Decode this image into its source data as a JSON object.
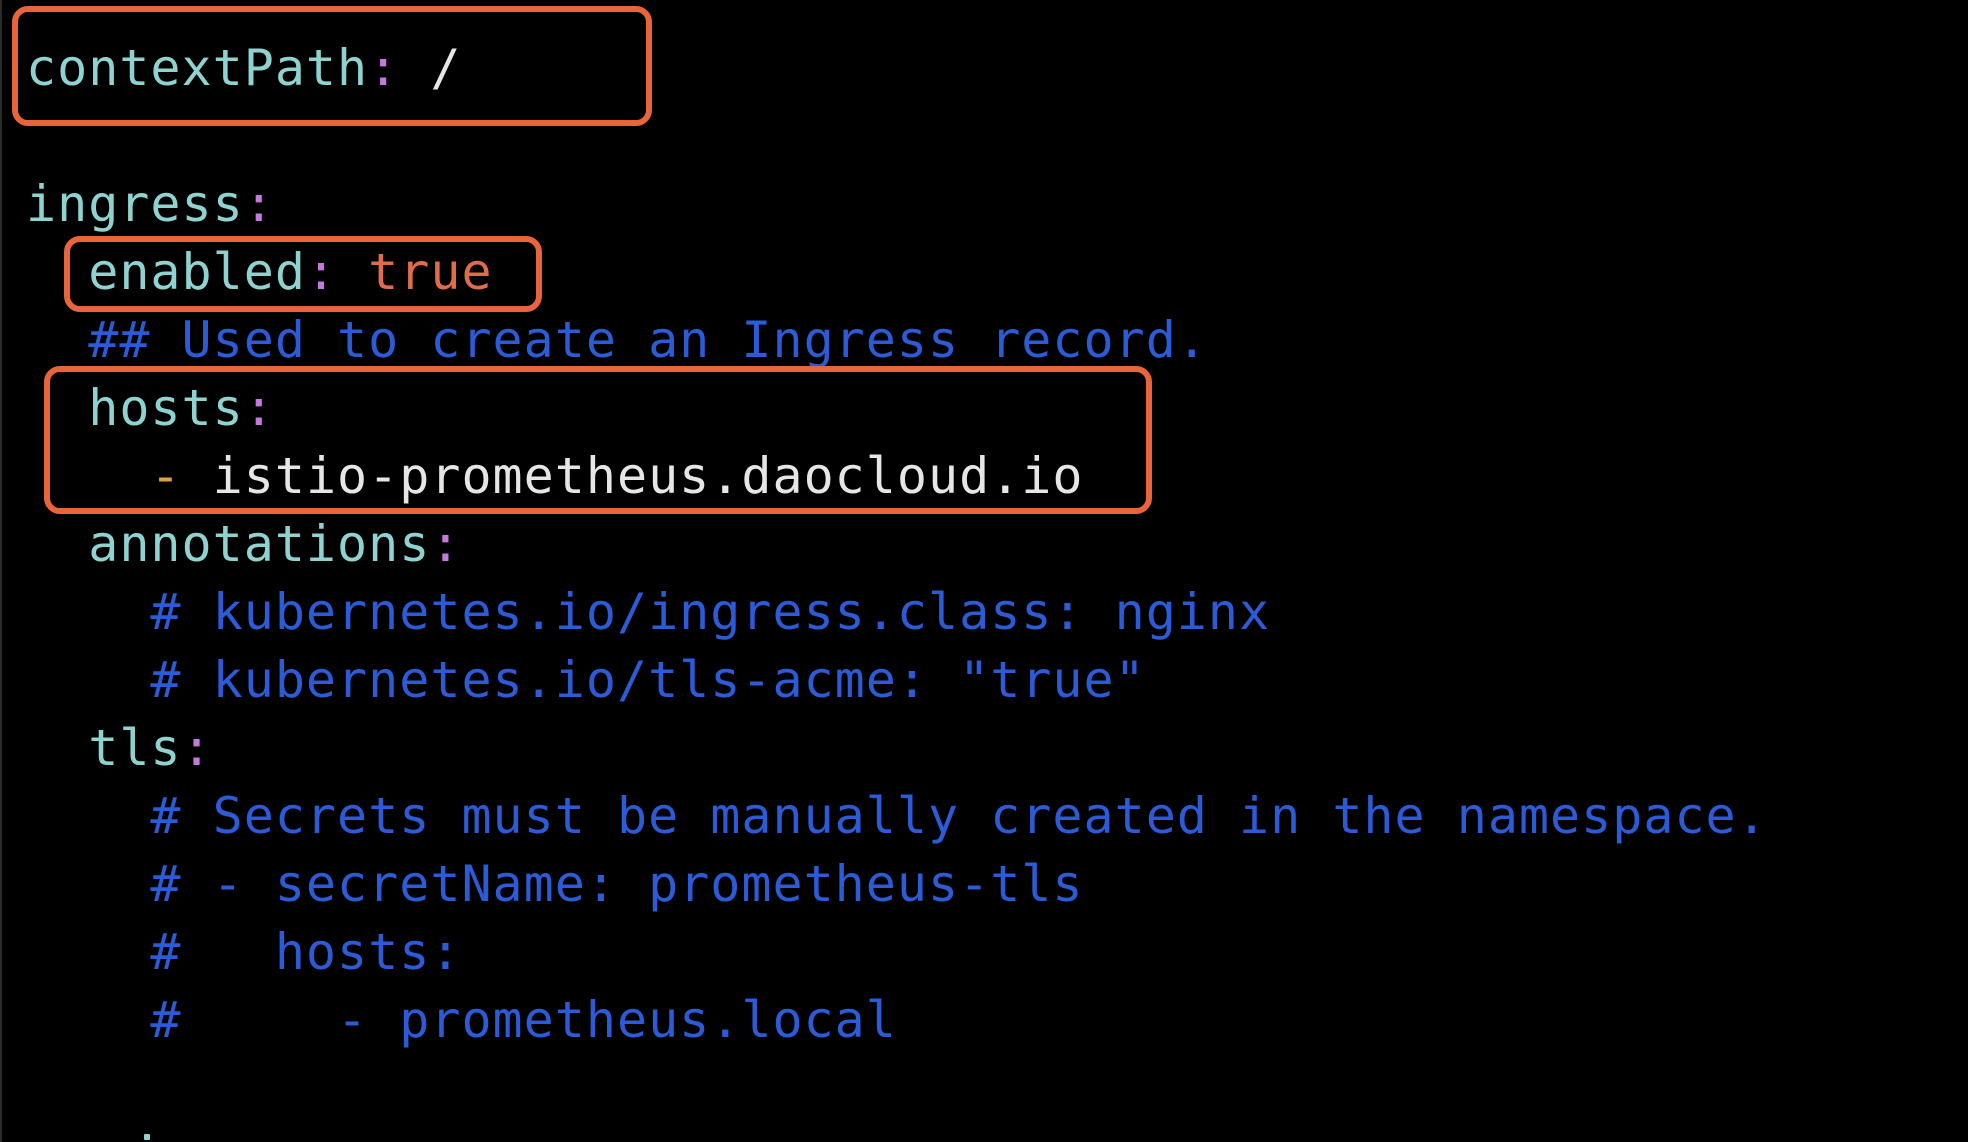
{
  "editor": {
    "lines": [
      {
        "indent": "",
        "key": "contextPath",
        "colon": ":",
        "value": " /"
      },
      {
        "indent": "",
        "key": "ingress",
        "colon": ":"
      },
      {
        "indent": "  ",
        "key": "enabled",
        "colon": ":",
        "bool": " true"
      },
      {
        "indent": "  ",
        "comment": "## Used to create an Ingress record."
      },
      {
        "indent": "  ",
        "key": "hosts",
        "colon": ":"
      },
      {
        "indent": "    ",
        "dash": "-",
        "value": " istio-prometheus.daocloud.io"
      },
      {
        "indent": "  ",
        "key": "annotations",
        "colon": ":"
      },
      {
        "indent": "    ",
        "comment": "# kubernetes.io/ingress.class: nginx"
      },
      {
        "indent": "    ",
        "comment": "# kubernetes.io/tls-acme: \"true\""
      },
      {
        "indent": "  ",
        "key": "tls",
        "colon": ":"
      },
      {
        "indent": "    ",
        "comment": "# Secrets must be manually created in the namespace."
      },
      {
        "indent": "    ",
        "comment": "# - secretName: prometheus-tls"
      },
      {
        "indent": "    ",
        "comment": "#   hosts:"
      },
      {
        "indent": "    ",
        "comment": "#     - prometheus.local"
      }
    ]
  },
  "colors": {
    "background": "#000000",
    "key": "#8fd3d0",
    "colon": "#c678dd",
    "value": "#e6e6e6",
    "boolean": "#e06c4a",
    "comment": "#2b5bd7",
    "highlight_box": "#e8643a"
  }
}
